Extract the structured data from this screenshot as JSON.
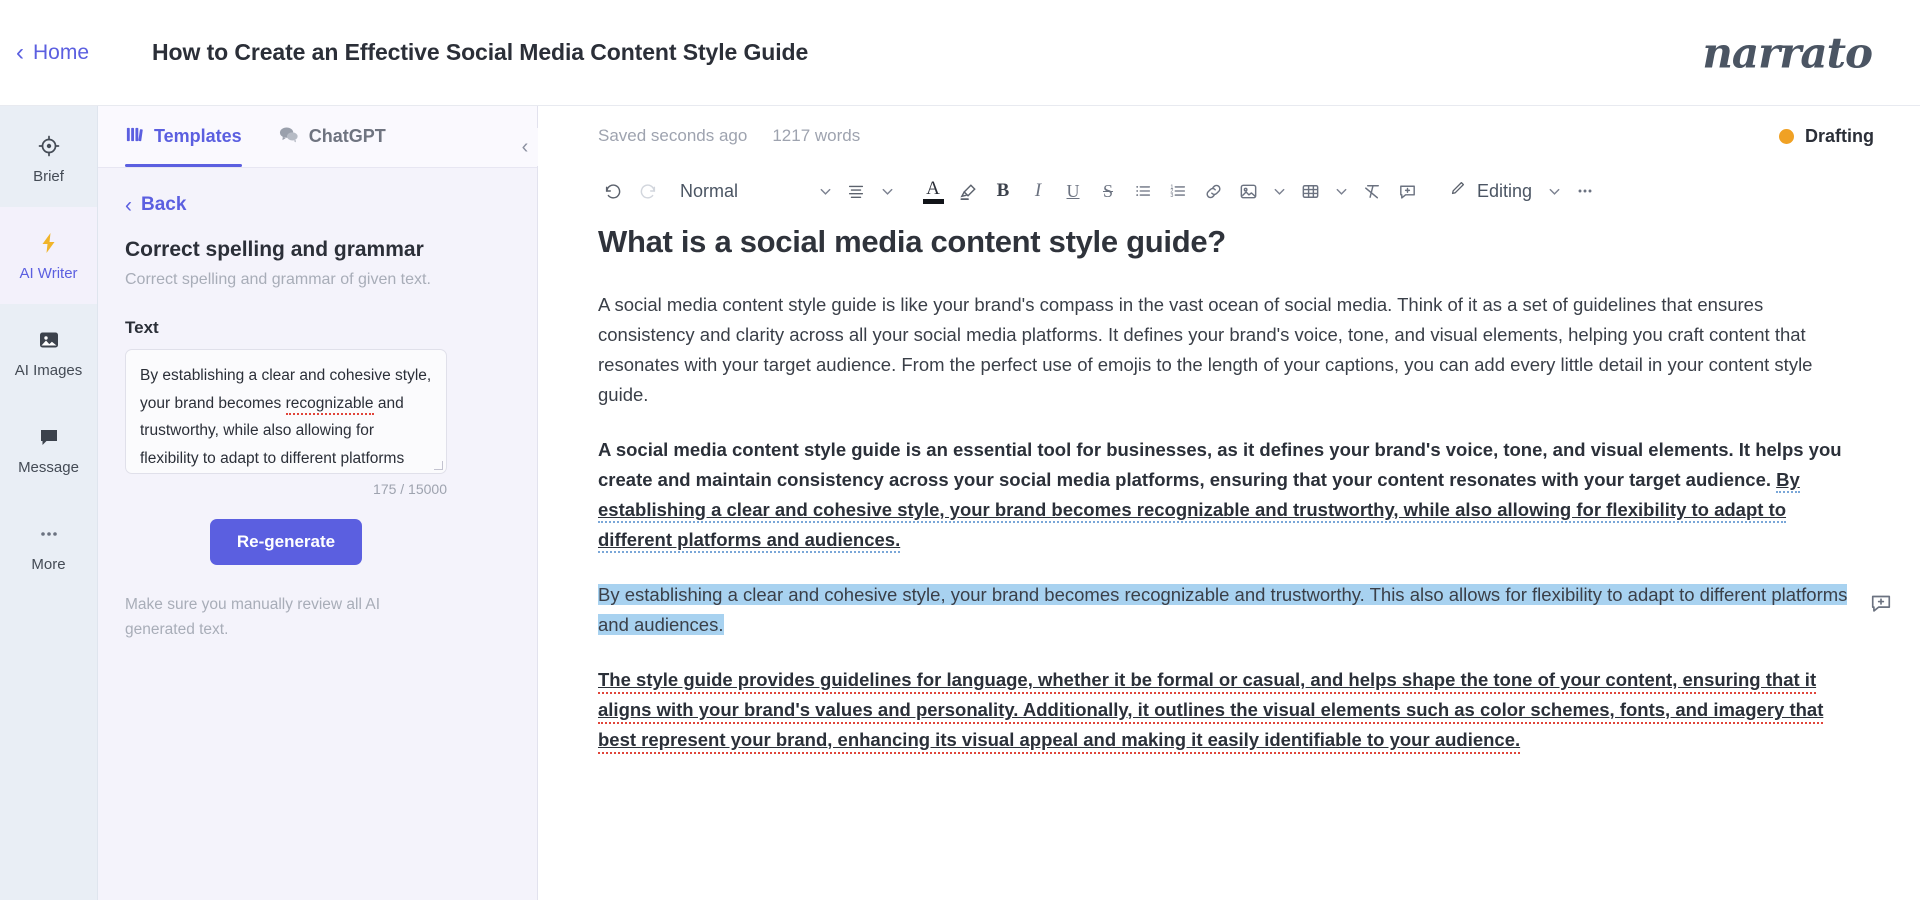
{
  "topbar": {
    "home_label": "Home",
    "doc_title": "How to Create an Effective Social Media Content Style Guide",
    "brand": "narrato",
    "accent_color": "#5b5fe0"
  },
  "rail": {
    "items": [
      {
        "label": "Brief",
        "icon": "target-icon",
        "active": false
      },
      {
        "label": "AI Writer",
        "icon": "lightning-icon",
        "active": true
      },
      {
        "label": "AI Images",
        "icon": "image-icon",
        "active": false
      },
      {
        "label": "Message",
        "icon": "chat-bubble-icon",
        "active": false
      },
      {
        "label": "More",
        "icon": "ellipsis-icon",
        "active": false
      }
    ]
  },
  "panel": {
    "tabs": [
      {
        "label": "Templates",
        "icon": "templates-icon",
        "active": true
      },
      {
        "label": "ChatGPT",
        "icon": "chat-icon",
        "active": false
      }
    ],
    "back_label": "Back",
    "template_title": "Correct spelling and grammar",
    "template_subtitle": "Correct spelling and grammar of given text.",
    "field_label": "Text",
    "textarea_value_a": "By establishing a clear and cohesive style, your brand becomes ",
    "textarea_value_flagged": "recognizable",
    "textarea_value_b": " and trustworthy, while also allowing for flexibility to adapt to different platforms and",
    "counter": "175 / 15000",
    "regenerate_label": "Re-generate",
    "disclaimer": "Make sure you manually review all AI generated text.",
    "collapse_icon": "chevron-left-icon"
  },
  "editor": {
    "saved_status": "Saved seconds ago",
    "word_count": "1217 words",
    "doc_state": "Drafting",
    "doc_state_color": "#f0a124",
    "toolbar": {
      "undo": "undo-icon",
      "redo": "redo-icon",
      "style_label": "Normal",
      "align": "align-icon",
      "font_color": "A",
      "highlight": "highlighter-icon",
      "bold": "B",
      "italic": "I",
      "underline": "U",
      "strikethrough": "S",
      "bullet_list": "bullet-list-icon",
      "numbered_list": "numbered-list-icon",
      "link": "link-icon",
      "image": "image-icon",
      "table": "table-icon",
      "clear_format": "clear-format-icon",
      "comment": "add-comment-icon",
      "mode_label": "Editing",
      "more": "ellipsis-icon"
    },
    "document": {
      "heading": "What is a social media content style guide?",
      "p1": "A social media content style guide is like your brand's compass in the vast ocean of social media. Think of it as a set of guidelines that ensures consistency and clarity across all your social media platforms. It defines your brand's voice, tone, and visual elements, helping you craft content that resonates with your target audience. From the perfect use of emojis to the length of your captions, you can add every little detail in your content style guide.",
      "p2_plain": "A social media content style guide is an essential tool for businesses, as it defines your brand's voice, tone, and visual elements. It helps you create and maintain consistency across your social media platforms, ensuring that your content resonates with your target audience. ",
      "p2_commented": "By establishing a clear and cohesive style, your brand becomes recognizable and trustworthy, while also allowing for flexibility to adapt to different platforms and audiences.",
      "p3_selected": "By establishing a clear and cohesive style, your brand becomes recognizable and trustworthy. This also allows for flexibility to adapt to different platforms and audiences.",
      "p4_flagged": "The style guide provides guidelines for language, whether it be formal or casual, and helps shape the tone of your content, ensuring that it aligns with your brand's values and personality. Additionally, it outlines the visual elements such as color schemes, fonts, and imagery that best represent your brand, enhancing its visual appeal and making it easily identifiable to your audience."
    }
  }
}
